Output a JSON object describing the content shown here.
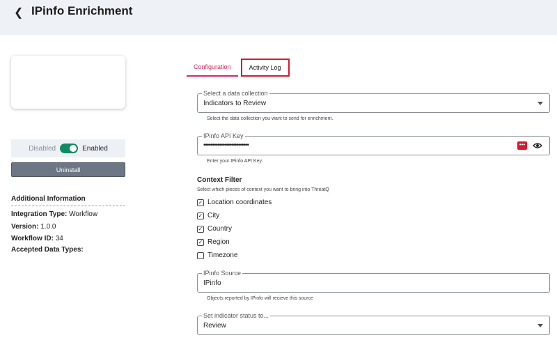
{
  "header": {
    "title": "IPinfo Enrichment"
  },
  "left": {
    "toggle": {
      "off_label": "Disabled",
      "on_label": "Enabled"
    },
    "uninstall_label": "Uninstall",
    "info": {
      "title": "Additional Information",
      "integration_type_label": "Integration Type:",
      "integration_type_value": "Workflow",
      "version_label": "Version:",
      "version_value": "1.0.0",
      "workflow_id_label": "Workflow ID:",
      "workflow_id_value": "34",
      "accepted_types_label": "Accepted Data Types:"
    }
  },
  "tabs": [
    {
      "label": "Configuration",
      "active": true
    },
    {
      "label": "Activity Log",
      "active": false
    }
  ],
  "form": {
    "collection": {
      "legend": "Select a data collection",
      "value": "Indicators to Review",
      "helper": "Select the data collection you want to send for enrichment."
    },
    "api_key": {
      "legend": "IPinfo API Key",
      "value": "••••••••••••••••••••••••••",
      "helper": "Enter your IPinfo API Key."
    },
    "context": {
      "title": "Context Filter",
      "subtitle": "Select which pieces of context you want to bring into ThreatQ",
      "options": [
        {
          "label": "Location coordinates",
          "checked": true
        },
        {
          "label": "City",
          "checked": true
        },
        {
          "label": "Country",
          "checked": true
        },
        {
          "label": "Region",
          "checked": true
        },
        {
          "label": "Timezone",
          "checked": false
        }
      ]
    },
    "source": {
      "legend": "IPinfo Source",
      "value": "IPinfo",
      "helper": "Objects reported by IPinfo will recieve this source"
    },
    "status": {
      "legend": "Set indicator status to...",
      "value": "Review"
    }
  },
  "colors": {
    "accent": "#e0245e",
    "toggle": "#0f8a63",
    "highlight": "#d9182e"
  }
}
